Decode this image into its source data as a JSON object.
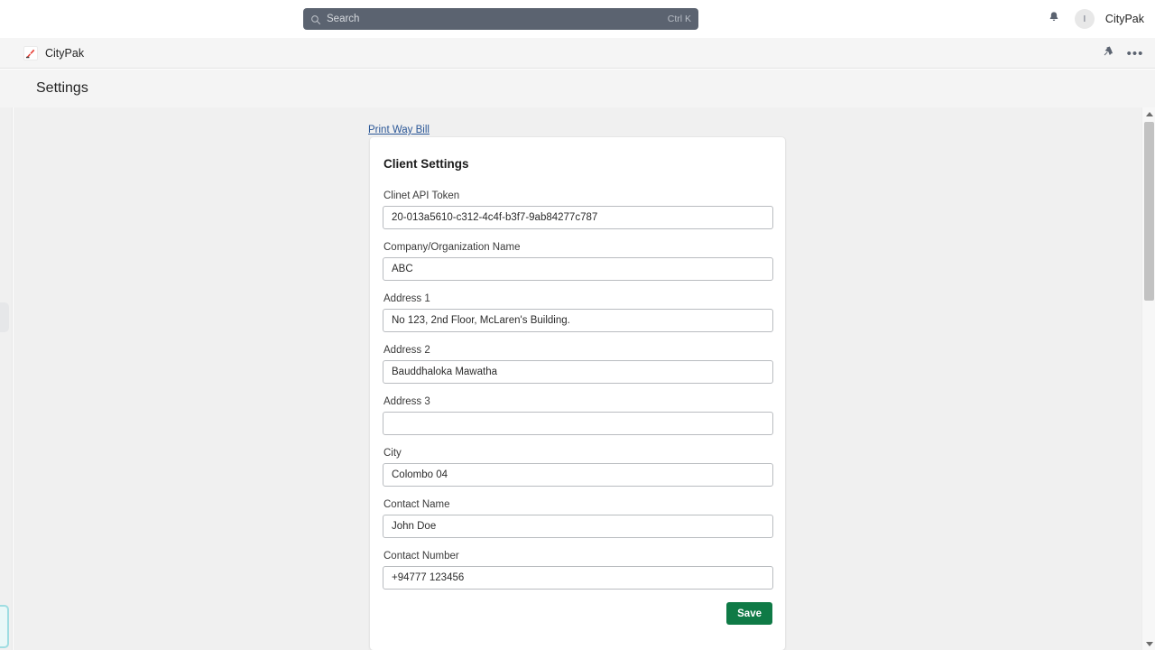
{
  "appbar": {
    "search": {
      "icon": "search-icon",
      "placeholder": "Search",
      "value": "",
      "shortcut": "Ctrl K"
    },
    "notifications_icon": "bell-icon",
    "avatar_initial": "I",
    "user_name": "CityPak"
  },
  "tabstrip": {
    "tab_label": "CityPak",
    "logo_icon": "citypak-logo-icon",
    "pin_icon": "pin-icon",
    "overflow_icon": "ellipsis-icon",
    "overflow_label": "•••"
  },
  "page": {
    "title": "Settings"
  },
  "content": {
    "print_way_bill_link": "Print Way Bill",
    "card": {
      "title": "Client Settings",
      "fields": [
        {
          "label": "Clinet API Token",
          "value": "20-013a5610-c312-4c4f-b3f7-9ab84277c787",
          "placeholder": ""
        },
        {
          "label": "Company/Organization Name",
          "value": "ABC",
          "placeholder": ""
        },
        {
          "label": "Address 1",
          "value": "No 123, 2nd Floor, McLaren's Building.",
          "placeholder": ""
        },
        {
          "label": "Address 2",
          "value": "Bauddhaloka Mawatha",
          "placeholder": ""
        },
        {
          "label": "Address 3",
          "value": "",
          "placeholder": ""
        },
        {
          "label": "City",
          "value": "Colombo 04",
          "placeholder": ""
        },
        {
          "label": "Contact Name",
          "value": "John Doe",
          "placeholder": ""
        },
        {
          "label": "Contact Number",
          "value": "+94777 123456",
          "placeholder": ""
        }
      ],
      "save_label": "Save"
    }
  },
  "scrollbar": {
    "up_icon": "scroll-up-arrow-icon",
    "down_icon": "scroll-down-arrow-icon"
  },
  "colors": {
    "accent_green": "#0f7a46",
    "link_blue": "#2b5797",
    "search_bg": "#5b6370",
    "page_bg": "#f0f0f0",
    "rail_chip_border": "#9fdde2"
  }
}
